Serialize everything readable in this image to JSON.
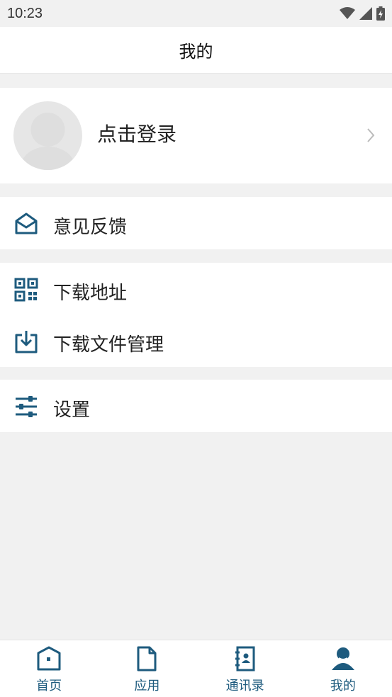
{
  "status_bar": {
    "time": "10:23"
  },
  "header": {
    "title": "我的"
  },
  "profile": {
    "login_label": "点击登录"
  },
  "menu": {
    "feedback": "意见反馈",
    "download_address": "下载地址",
    "download_files": "下载文件管理",
    "settings": "设置"
  },
  "tabs": [
    {
      "label": "首页",
      "icon": "home-icon"
    },
    {
      "label": "应用",
      "icon": "document-icon"
    },
    {
      "label": "通讯录",
      "icon": "contacts-icon"
    },
    {
      "label": "我的",
      "icon": "user-icon",
      "active": true
    }
  ],
  "colors": {
    "accent": "#1e5b7e",
    "background": "#f1f1f1",
    "card": "#ffffff"
  }
}
